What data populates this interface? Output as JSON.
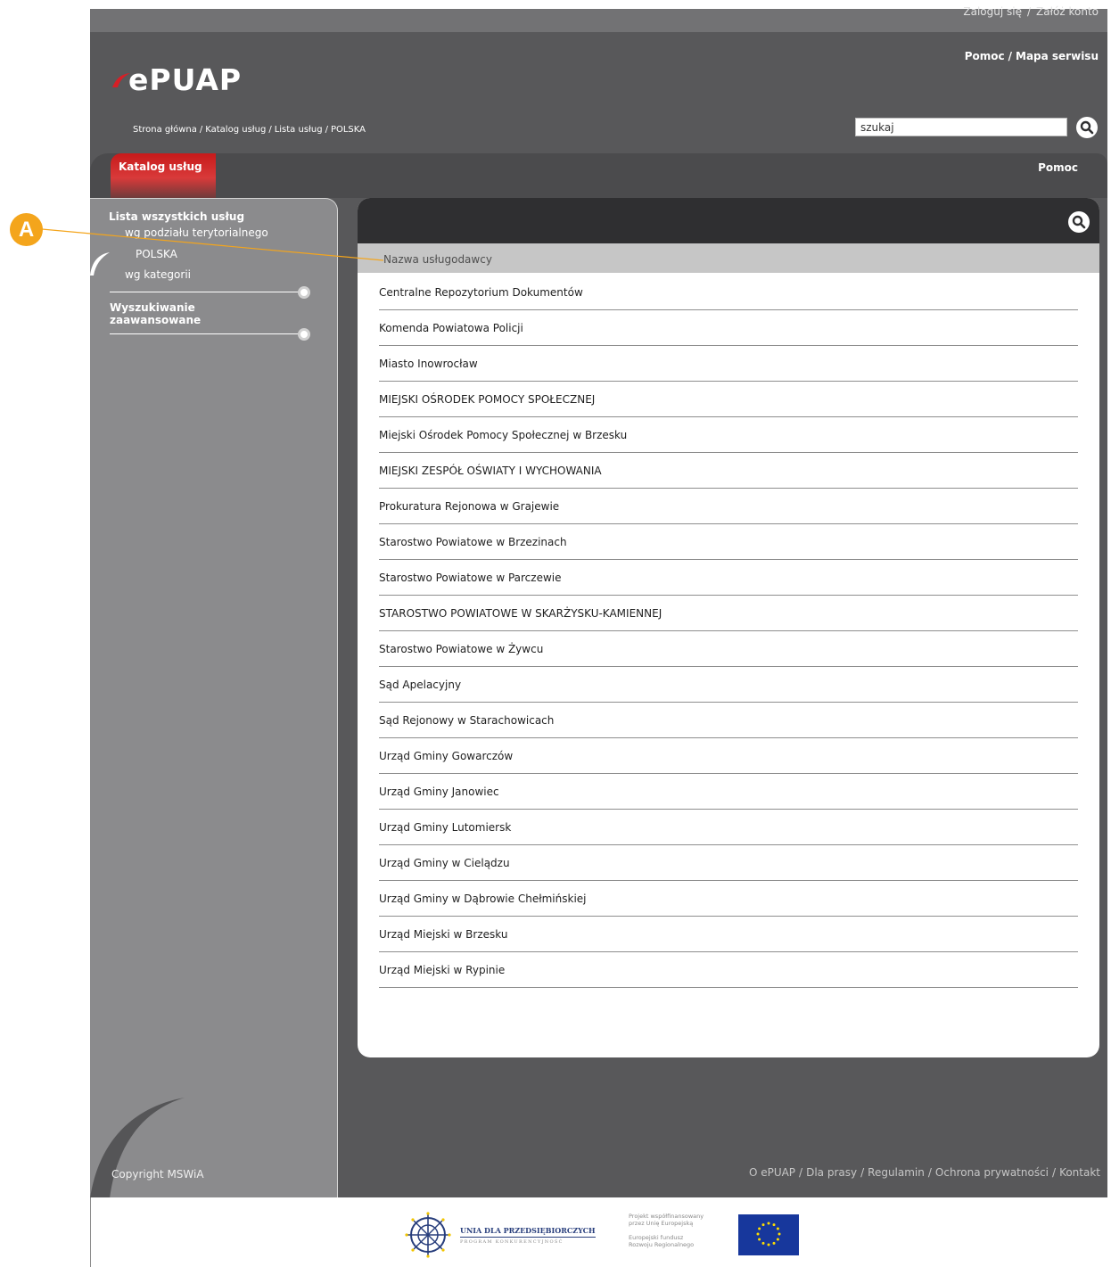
{
  "topbar": {
    "login": "Zaloguj się",
    "separator": "/",
    "register": "Załóż konto"
  },
  "header": {
    "help": "Pomoc",
    "separator": "/",
    "sitemap": "Mapa serwisu",
    "logo": "ePUAP",
    "breadcrumb": [
      "Strona główna",
      "Katalog usług",
      "Lista usług",
      "POLSKA"
    ],
    "breadcrumb_separator": "/",
    "search_value": "szukaj"
  },
  "nav": {
    "active_tab": "Katalog usług",
    "help": "Pomoc"
  },
  "sidebar": {
    "section1_title": "Lista wszystkich usług",
    "by_territory": "wg podziału terytorialnego",
    "country": "POLSKA",
    "by_category": "wg kategorii",
    "section2_title_line1": "Wyszukiwanie",
    "section2_title_line2": "zaawansowane",
    "copyright": "Copyright MSWiA"
  },
  "content": {
    "column_header": "Nazwa usługodawcy",
    "providers": [
      "Centralne Repozytorium Dokumentów",
      "Komenda Powiatowa Policji",
      "Miasto Inowrocław",
      "MIEJSKI OŚRODEK POMOCY SPOŁECZNEJ",
      "Miejski Ośrodek Pomocy Społecznej w Brzesku",
      "MIEJSKI ZESPÓŁ OŚWIATY I WYCHOWANIA",
      "Prokuratura Rejonowa w Grajewie",
      "Starostwo Powiatowe w Brzezinach",
      "Starostwo Powiatowe w Parczewie",
      "STAROSTWO POWIATOWE W SKARŻYSKU-KAMIENNEJ",
      "Starostwo Powiatowe w Żywcu",
      "Sąd Apelacyjny",
      "Sąd Rejonowy w Starachowicach",
      "Urząd Gminy Gowarczów",
      "Urząd Gminy Janowiec",
      "Urząd Gminy Lutomiersk",
      "Urząd Gminy w Cielądzu",
      "Urząd Gminy w Dąbrowie Chełmińskiej",
      "Urząd Miejski w Brzesku",
      "Urząd Miejski w Rypinie"
    ]
  },
  "footer": {
    "links": [
      "O ePUAP",
      "Dla prasy",
      "Regulamin",
      "Ochrona prywatności",
      "Kontakt"
    ],
    "separator": "/"
  },
  "sponsors": {
    "union_title": "UNIA DLA PRZEDSIĘBIORCZYCH",
    "union_subtitle": "PROGRAM KONKURENCYJNOŚĆ",
    "eu_line1": "Projekt współfinansowany",
    "eu_line2": "przez Unię Europejską",
    "eu_line3": "Europejski fundusz",
    "eu_line4": "Rozwoju Regionalnego"
  },
  "callout": {
    "label": "A"
  },
  "colors": {
    "frame": "#58585a",
    "sidebar": "#8b8b8d",
    "accent_red": "#c71a1a",
    "callout_orange": "#f4a51c"
  },
  "icons": [
    "search-icon",
    "logo-swoosh-icon",
    "sidebar-knob-icon",
    "union-emblem-icon",
    "eu-flag-icon"
  ]
}
